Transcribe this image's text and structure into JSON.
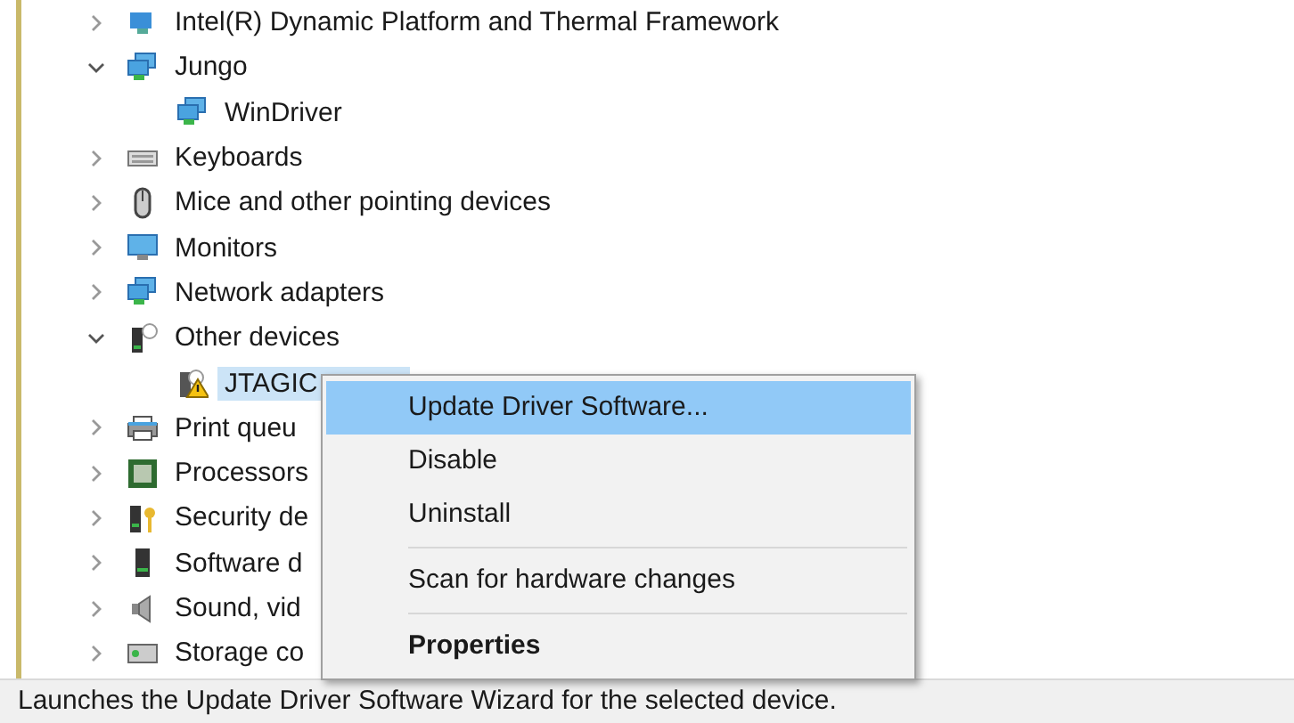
{
  "tree": [
    {
      "label": "Intel(R) Dynamic Platform and Thermal Framework",
      "kind": "computer",
      "expanded": false,
      "selected": false
    },
    {
      "label": "Jungo",
      "kind": "network",
      "expanded": true,
      "selected": false,
      "children": [
        {
          "label": "WinDriver",
          "kind": "network",
          "selected": false
        }
      ]
    },
    {
      "label": "Keyboards",
      "kind": "keyboard",
      "expanded": false,
      "selected": false
    },
    {
      "label": "Mice and other pointing devices",
      "kind": "mouse",
      "expanded": false,
      "selected": false
    },
    {
      "label": "Monitors",
      "kind": "monitor",
      "expanded": false,
      "selected": false
    },
    {
      "label": "Network adapters",
      "kind": "network",
      "expanded": false,
      "selected": false
    },
    {
      "label": "Other devices",
      "kind": "unknown",
      "expanded": true,
      "selected": false,
      "children": [
        {
          "label": "JTAGIC",
          "kind": "warning",
          "selected": true
        }
      ]
    },
    {
      "label": "Print queu",
      "kind": "printer",
      "expanded": false,
      "selected": false
    },
    {
      "label": "Processors",
      "kind": "chip",
      "expanded": false,
      "selected": false
    },
    {
      "label": "Security de",
      "kind": "key",
      "expanded": false,
      "selected": false
    },
    {
      "label": "Software d",
      "kind": "tower",
      "expanded": false,
      "selected": false
    },
    {
      "label": "Sound, vid",
      "kind": "speaker",
      "expanded": false,
      "selected": false
    },
    {
      "label": "Storage co",
      "kind": "storage",
      "expanded": false,
      "selected": false
    }
  ],
  "context_menu": [
    {
      "kind": "item",
      "label": "Update Driver Software...",
      "selected": true
    },
    {
      "kind": "item",
      "label": "Disable",
      "selected": false
    },
    {
      "kind": "item",
      "label": "Uninstall",
      "selected": false
    },
    {
      "kind": "separator"
    },
    {
      "kind": "item",
      "label": "Scan for hardware changes",
      "selected": false
    },
    {
      "kind": "separator"
    },
    {
      "kind": "default",
      "label": "Properties",
      "selected": false
    }
  ],
  "status_bar": "Launches the Update Driver Software Wizard for the selected device."
}
